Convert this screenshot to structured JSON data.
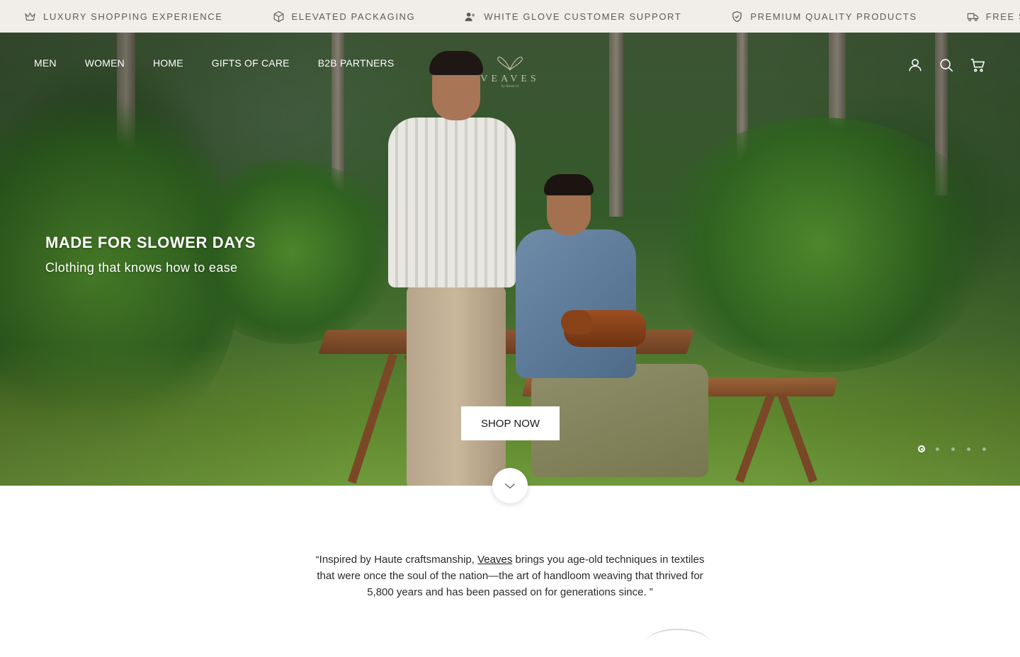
{
  "announcement": {
    "items": [
      {
        "label": "LUXURY SHOPPING EXPERIENCE",
        "icon": "crown-icon"
      },
      {
        "label": "ELEVATED PACKAGING",
        "icon": "box-icon"
      },
      {
        "label": "WHITE GLOVE CUSTOMER SUPPORT",
        "icon": "support-users-icon"
      },
      {
        "label": "PREMIUM QUALITY PRODUCTS",
        "icon": "shield-check-icon"
      },
      {
        "label": "FREE SHIPPING",
        "icon": "truck-icon"
      }
    ]
  },
  "header": {
    "nav": [
      "MEN",
      "WOMEN",
      "HOME",
      "GIFTS OF CARE",
      "B2B PARTNERS"
    ],
    "logo_text": "VEAVES",
    "logo_sub": "by House of",
    "icons": [
      "account-icon",
      "search-icon",
      "cart-icon"
    ]
  },
  "hero": {
    "title": "MADE FOR SLOWER DAYS",
    "subtitle": "Clothing that knows how to ease",
    "cta": "SHOP NOW",
    "slides_total": 5,
    "active_slide": 1
  },
  "quote": {
    "before": "“Inspired by Haute craftsmanship, ",
    "brand": "Veaves",
    "after": " brings you age-old techniques in textiles that were once the soul of the nation—the art of handloom weaving that thrived for 5,800 years and has been passed on for generations since. ”"
  },
  "colors": {
    "announcement_bg": "#f1ede8",
    "announcement_text": "#5e5a55",
    "button_bg": "#ffffff",
    "text_dark": "#1c1c1c"
  }
}
